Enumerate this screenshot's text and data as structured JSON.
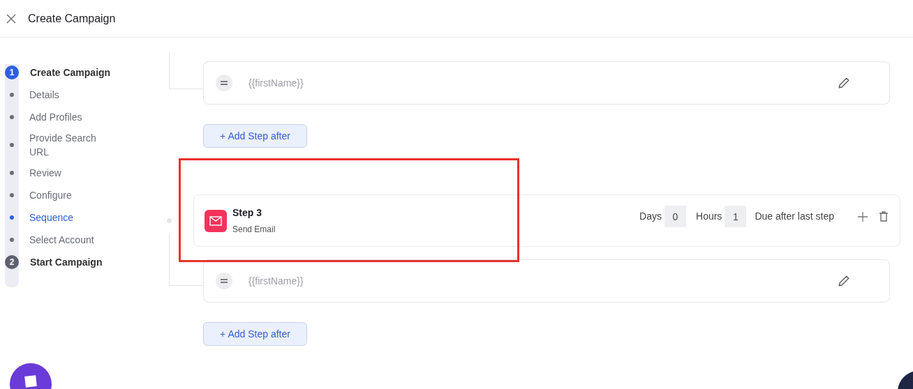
{
  "header": {
    "title": "Create Campaign"
  },
  "sidebar": {
    "steps": [
      {
        "number": "1",
        "label": "Create Campaign",
        "active": true,
        "substeps": [
          {
            "label": "Details",
            "selected": false
          },
          {
            "label": "Add Profiles",
            "selected": false
          },
          {
            "label": "Provide Search URL",
            "selected": false
          },
          {
            "label": "Review",
            "selected": false
          },
          {
            "label": "Configure",
            "selected": false
          },
          {
            "label": "Sequence",
            "selected": true
          },
          {
            "label": "Select Account",
            "selected": false
          }
        ]
      },
      {
        "number": "2",
        "label": "Start Campaign",
        "active": false
      }
    ]
  },
  "sequence": [
    {
      "kind": "message",
      "text": "{{firstName}}"
    },
    {
      "kind": "add_button",
      "label": "+ Add Step after"
    },
    {
      "kind": "step",
      "title": "Step 3",
      "subtitle": "Send Email",
      "days_label": "Days",
      "days": "0",
      "hours_label": "Hours",
      "hours": "1",
      "due": "Due after last step"
    },
    {
      "kind": "message",
      "text": "{{firstName}}"
    },
    {
      "kind": "add_button",
      "label": "+ Add Step after"
    }
  ]
}
